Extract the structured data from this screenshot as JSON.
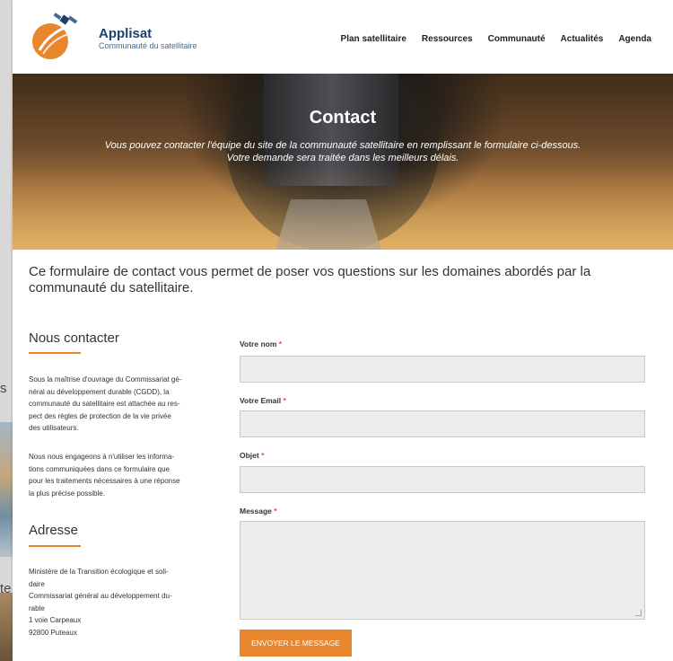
{
  "brand": {
    "title": "Applisat",
    "subtitle": "Communauté du satellitaire"
  },
  "nav": {
    "items": [
      "Plan satellitaire",
      "Ressources",
      "Communauté",
      "Actualités",
      "Agenda"
    ]
  },
  "hero": {
    "title": "Contact",
    "intro_line1": "Vous pouvez contacter l'équipe du site de la communauté satellitaire en remplissant le formulaire ci-dessous.",
    "intro_line2": "Votre demande sera traitée dans les meilleurs délais."
  },
  "lead": "Ce formulaire de contact vous permet de poser vos questions sur les domaines abordés par la communauté du satellitaire.",
  "contact": {
    "title": "Nous contacter",
    "p1": "Sous la maîtrise d'ouvrage du Commissariat gé-\nnéral au développement durable (CGDD), la\ncommunauté du satellitaire est attachée au res-\npect des règles de protection de la vie privée\ndes utilisateurs.",
    "p2": "Nous nous engageons à n'utiliser les informa-\ntions communiquées dans ce formulaire que\npour les traitements nécessaires à une réponse\nla plus précise possible."
  },
  "address": {
    "title": "Adresse",
    "text": "Ministère de la Transition écologique et soli-\ndaire\nCommissariat général au développement du-\nrable\n1 voie Carpeaux\n92800 Puteaux"
  },
  "form": {
    "name_label": "Votre nom",
    "email_label": "Votre Email",
    "subject_label": "Objet",
    "message_label": "Message",
    "required_mark": "*",
    "submit_label": "ENVOYER LE MESSAGE"
  },
  "background": {
    "frag1": "s",
    "frag2": "te"
  },
  "colors": {
    "accent": "#e8862d",
    "brand": "#1c3f6e",
    "required": "#e04a3a"
  }
}
